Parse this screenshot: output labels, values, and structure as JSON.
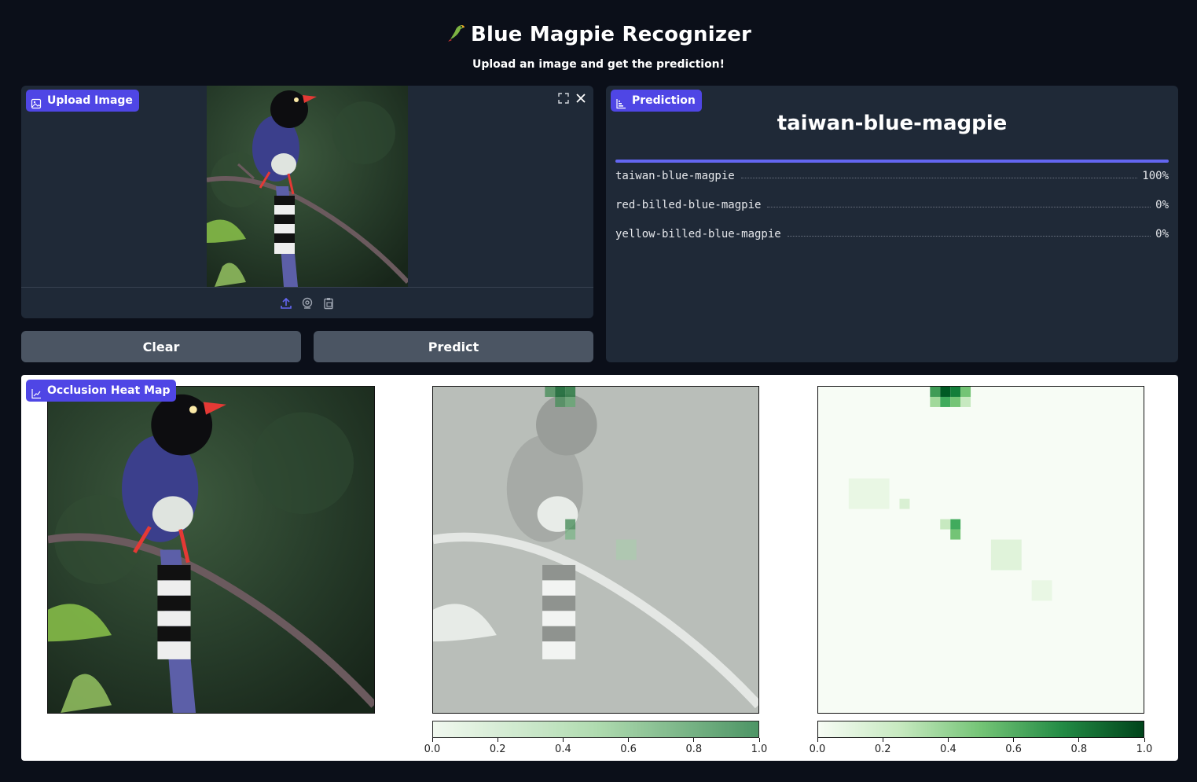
{
  "header": {
    "title": "Blue Magpie Recognizer",
    "subtitle": "Upload an image and get the prediction!"
  },
  "upload": {
    "label": "Upload Image",
    "clear_label": "Clear",
    "predict_label": "Predict"
  },
  "prediction": {
    "label": "Prediction",
    "top_class": "taiwan-blue-magpie",
    "confidences": [
      {
        "label": "taiwan-blue-magpie",
        "value_text": "100%",
        "value": 1.0
      },
      {
        "label": "red-billed-blue-magpie",
        "value_text": "0%",
        "value": 0.0
      },
      {
        "label": "yellow-billed-blue-magpie",
        "value_text": "0%",
        "value": 0.0
      }
    ]
  },
  "heatmap": {
    "label": "Occlusion Heat Map",
    "colorbar_ticks": [
      "0.0",
      "0.2",
      "0.4",
      "0.6",
      "0.8",
      "1.0"
    ]
  },
  "colors": {
    "accent": "#4f46e5",
    "bar": "#6366f1",
    "button": "#4b5563",
    "panel": "#1f2937",
    "background": "#0b0f19"
  }
}
